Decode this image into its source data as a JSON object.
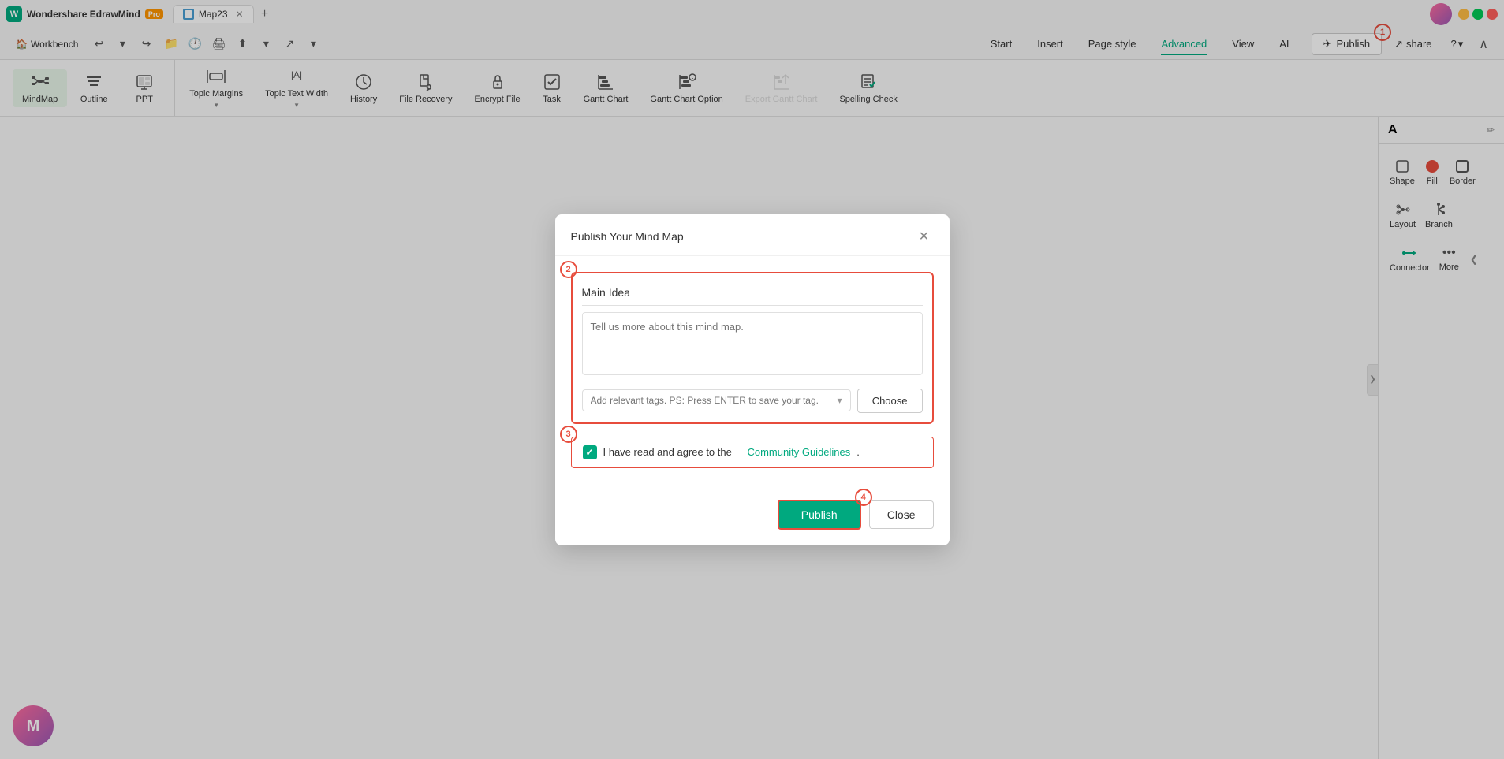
{
  "app": {
    "name": "Wondershare EdrawMind",
    "pro_badge": "Pro",
    "tab_name": "Map23",
    "window_controls": {
      "min": "—",
      "max": "❐",
      "close": "✕"
    }
  },
  "toolbar_left": {
    "undo_label": "↩",
    "redo_label": "↪",
    "workbench_label": "Workbench"
  },
  "view_modes": [
    {
      "id": "mindmap",
      "label": "MindMap",
      "active": true
    },
    {
      "id": "outline",
      "label": "Outline",
      "active": false
    },
    {
      "id": "ppt",
      "label": "PPT",
      "active": false
    }
  ],
  "tools": [
    {
      "id": "topic-margins",
      "label": "Topic Margins",
      "has_arrow": true
    },
    {
      "id": "topic-text-width",
      "label": "Topic Text Width",
      "has_arrow": true
    },
    {
      "id": "history",
      "label": "History"
    },
    {
      "id": "file-recovery",
      "label": "File Recovery"
    },
    {
      "id": "encrypt-file",
      "label": "Encrypt File"
    },
    {
      "id": "task",
      "label": "Task"
    },
    {
      "id": "gantt-chart",
      "label": "Gantt Chart"
    },
    {
      "id": "gantt-chart-option",
      "label": "Gantt Chart Option"
    },
    {
      "id": "export-gantt-chart",
      "label": "Export Gantt Chart",
      "disabled": true
    },
    {
      "id": "spelling-check",
      "label": "Spelling Check"
    }
  ],
  "nav_menu": [
    {
      "id": "start",
      "label": "Start",
      "active": false
    },
    {
      "id": "insert",
      "label": "Insert",
      "active": false
    },
    {
      "id": "page-style",
      "label": "Page style",
      "active": false
    },
    {
      "id": "advanced",
      "label": "Advanced",
      "active": true
    },
    {
      "id": "view",
      "label": "View",
      "active": false
    },
    {
      "id": "ai",
      "label": "AI",
      "active": false
    }
  ],
  "header_buttons": {
    "publish": "Publish",
    "share": "share",
    "help": "?",
    "collapse": "∧"
  },
  "right_panel": {
    "buttons": [
      {
        "id": "font",
        "label": "A"
      },
      {
        "id": "shape",
        "label": "Shape"
      },
      {
        "id": "fill",
        "label": "Fill"
      },
      {
        "id": "border",
        "label": "Border"
      },
      {
        "id": "layout",
        "label": "Layout"
      },
      {
        "id": "branch",
        "label": "Branch"
      },
      {
        "id": "connector",
        "label": "Connector"
      },
      {
        "id": "more",
        "label": "More"
      }
    ]
  },
  "modal": {
    "title": "Publish Your Mind Map",
    "title_input_value": "Main Idea",
    "desc_placeholder": "Tell us more about this mind map.",
    "tags_placeholder": "Add relevant tags. PS: Press ENTER to save your tag.",
    "choose_button": "Choose",
    "checkbox_checked": true,
    "agree_text": "I have read and agree to the",
    "community_guidelines_text": "Community Guidelines",
    "agree_suffix": ".",
    "publish_button": "Publish",
    "close_button": "Close"
  },
  "annotations": {
    "num1": "1",
    "num2": "2",
    "num3": "3",
    "num4": "4"
  },
  "icons": {
    "mindmap": "✦",
    "outline": "☰",
    "ppt": "▦",
    "topic_margins": "⊞",
    "topic_text_width": "⟷",
    "history": "🕐",
    "file_recovery": "🗂",
    "encrypt_file": "🔒",
    "task": "☑",
    "gantt": "📊",
    "gantt_option": "⚙",
    "export_gantt": "⬆",
    "spelling": "📝",
    "publish": "✈",
    "share": "↗",
    "close": "✕",
    "checkbox": "✓",
    "font": "A",
    "collapse": "❯"
  }
}
